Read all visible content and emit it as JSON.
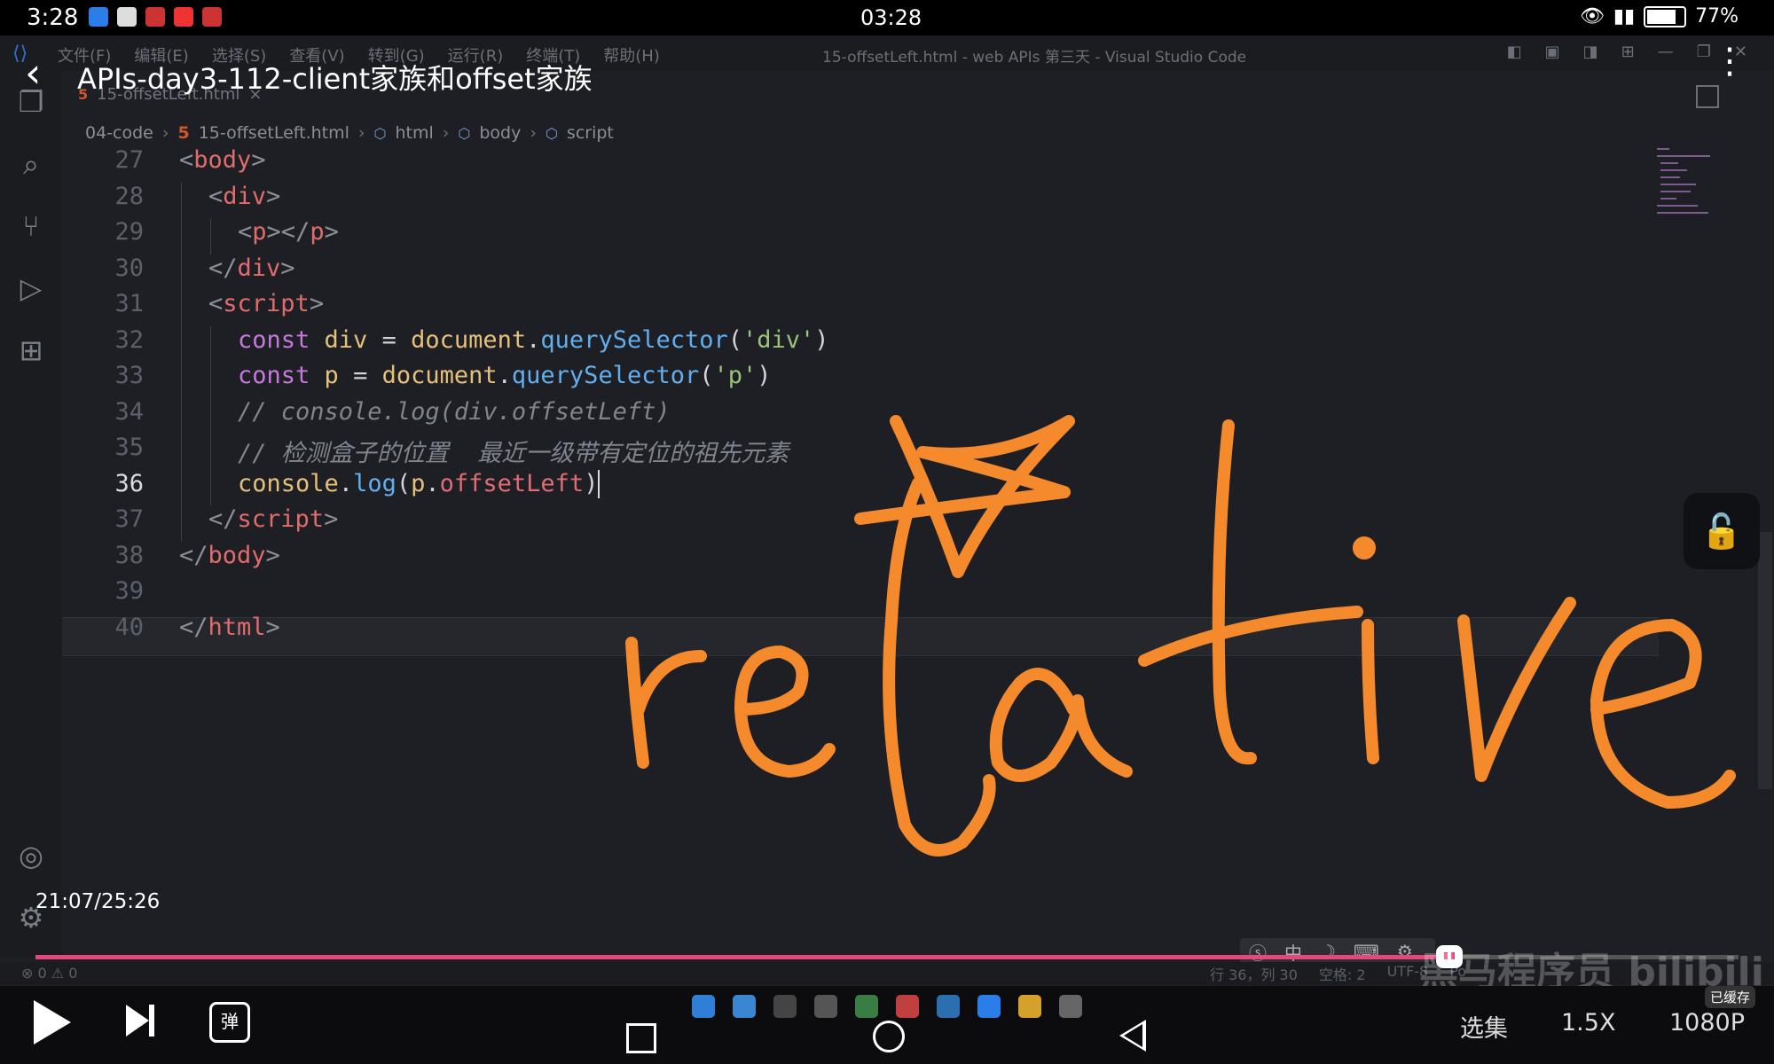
{
  "status_bar": {
    "time_left": "3:28",
    "time_center": "03:28",
    "battery": "77%"
  },
  "vscode": {
    "menu": [
      "文件(F)",
      "编辑(E)",
      "选择(S)",
      "查看(V)",
      "转到(G)",
      "运行(R)",
      "终端(T)",
      "帮助(H)"
    ],
    "window_title": "15-offsetLeft.html - web APIs 第三天 - Visual Studio Code",
    "tab": {
      "icon": "5",
      "label": "15-offsetLeft.html",
      "close": "×"
    },
    "breadcrumb": {
      "folder": "04-code",
      "file_icon": "5",
      "file": "15-offsetLeft.html",
      "html": "html",
      "body": "body",
      "script": "script"
    },
    "lines": [
      {
        "n": "27",
        "tokens": [
          [
            "tg",
            "<"
          ],
          [
            "tn",
            "body"
          ],
          [
            "tg",
            ">"
          ]
        ],
        "indent": 0
      },
      {
        "n": "28",
        "tokens": [
          [
            "tg",
            "<"
          ],
          [
            "tn",
            "div"
          ],
          [
            "tg",
            ">"
          ]
        ],
        "indent": 1
      },
      {
        "n": "29",
        "tokens": [
          [
            "tg",
            "<"
          ],
          [
            "tn",
            "p"
          ],
          [
            "tg",
            "></"
          ],
          [
            "tn",
            "p"
          ],
          [
            "tg",
            ">"
          ]
        ],
        "indent": 2
      },
      {
        "n": "30",
        "tokens": [
          [
            "tg",
            "</"
          ],
          [
            "tn",
            "div"
          ],
          [
            "tg",
            ">"
          ]
        ],
        "indent": 1
      },
      {
        "n": "31",
        "tokens": [
          [
            "tg",
            "<"
          ],
          [
            "tn",
            "script"
          ],
          [
            "tg",
            ">"
          ]
        ],
        "indent": 1
      },
      {
        "n": "32",
        "tokens": [
          [
            "kw",
            "const "
          ],
          [
            "vr",
            "div"
          ],
          [
            "pl",
            " = "
          ],
          [
            "vr",
            "document"
          ],
          [
            "pl",
            "."
          ],
          [
            "fn",
            "querySelector"
          ],
          [
            "pl",
            "("
          ],
          [
            "st",
            "'div'"
          ],
          [
            "pl",
            ")"
          ]
        ],
        "indent": 2
      },
      {
        "n": "33",
        "tokens": [
          [
            "kw",
            "const "
          ],
          [
            "vr",
            "p"
          ],
          [
            "pl",
            " = "
          ],
          [
            "vr",
            "document"
          ],
          [
            "pl",
            "."
          ],
          [
            "fn",
            "querySelector"
          ],
          [
            "pl",
            "("
          ],
          [
            "st",
            "'p'"
          ],
          [
            "pl",
            ")"
          ]
        ],
        "indent": 2
      },
      {
        "n": "34",
        "tokens": [
          [
            "cm",
            "// console.log(div.offsetLeft)"
          ]
        ],
        "indent": 2
      },
      {
        "n": "35",
        "tokens": [
          [
            "cm",
            "// 检测盒子的位置  最近一级带有定位的祖先元素"
          ]
        ],
        "indent": 2
      },
      {
        "n": "36",
        "tokens": [
          [
            "vr",
            "console"
          ],
          [
            "pl",
            "."
          ],
          [
            "fn",
            "log"
          ],
          [
            "pl",
            "("
          ],
          [
            "vr",
            "p"
          ],
          [
            "pl",
            "."
          ],
          [
            "pp",
            "offsetLeft"
          ],
          [
            "pl",
            ")"
          ]
        ],
        "indent": 2,
        "active": true
      },
      {
        "n": "37",
        "tokens": [
          [
            "tg",
            "</"
          ],
          [
            "tn",
            "script"
          ],
          [
            "tg",
            ">"
          ]
        ],
        "indent": 1
      },
      {
        "n": "38",
        "tokens": [
          [
            "tg",
            "</"
          ],
          [
            "tn",
            "body"
          ],
          [
            "tg",
            ">"
          ]
        ],
        "indent": 0
      },
      {
        "n": "39",
        "tokens": [],
        "indent": 0
      },
      {
        "n": "40",
        "tokens": [
          [
            "tg",
            "</"
          ],
          [
            "tn",
            "html"
          ],
          [
            "tg",
            ">"
          ]
        ],
        "indent": 0
      }
    ],
    "status": {
      "problems": "⊗ 0 ⚠ 0",
      "position": "行 36，列 30",
      "spaces": "空格: 2",
      "encoding": "UTF-8",
      "port": "Po"
    }
  },
  "video": {
    "title": "APIs-day3-112-client家族和offset家族",
    "timestamp": "21:07/25:26",
    "progress": 0.83,
    "annotation_text": "relative",
    "watermark": "黑马程序员 bilibili",
    "danmaku_label": "弹",
    "select_episodes": "选集",
    "speed": "1.5X",
    "quality": "1080P",
    "cached": "已缓存"
  },
  "colors": {
    "accent": "#e4477a",
    "annotation": "#f58a2c"
  }
}
